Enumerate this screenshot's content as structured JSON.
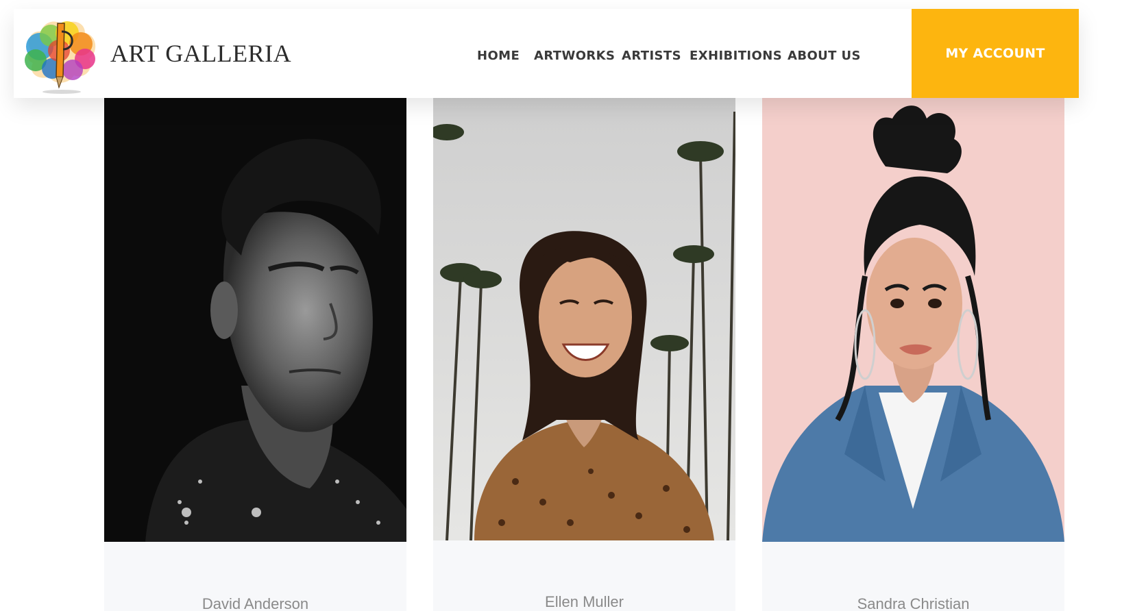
{
  "brand": {
    "name": "ART GALLERIA",
    "logo_icon": "paint-splash-logo-icon"
  },
  "nav": {
    "items": [
      {
        "label": "HOME"
      },
      {
        "label": "ARTWORKS"
      },
      {
        "label": "ARTISTS"
      },
      {
        "label": "EXHIBITIONS"
      },
      {
        "label": "ABOUT US"
      }
    ],
    "account_button": "MY ACCOUNT"
  },
  "artists": [
    {
      "name": "David Anderson"
    },
    {
      "name": "Ellen Muller"
    },
    {
      "name": "Sandra Christian"
    }
  ],
  "colors": {
    "accent": "#fdb50f",
    "nav_text": "#3a3a3a",
    "artist_name": "#8a8a8a",
    "card_background": "#f7f8fa"
  }
}
